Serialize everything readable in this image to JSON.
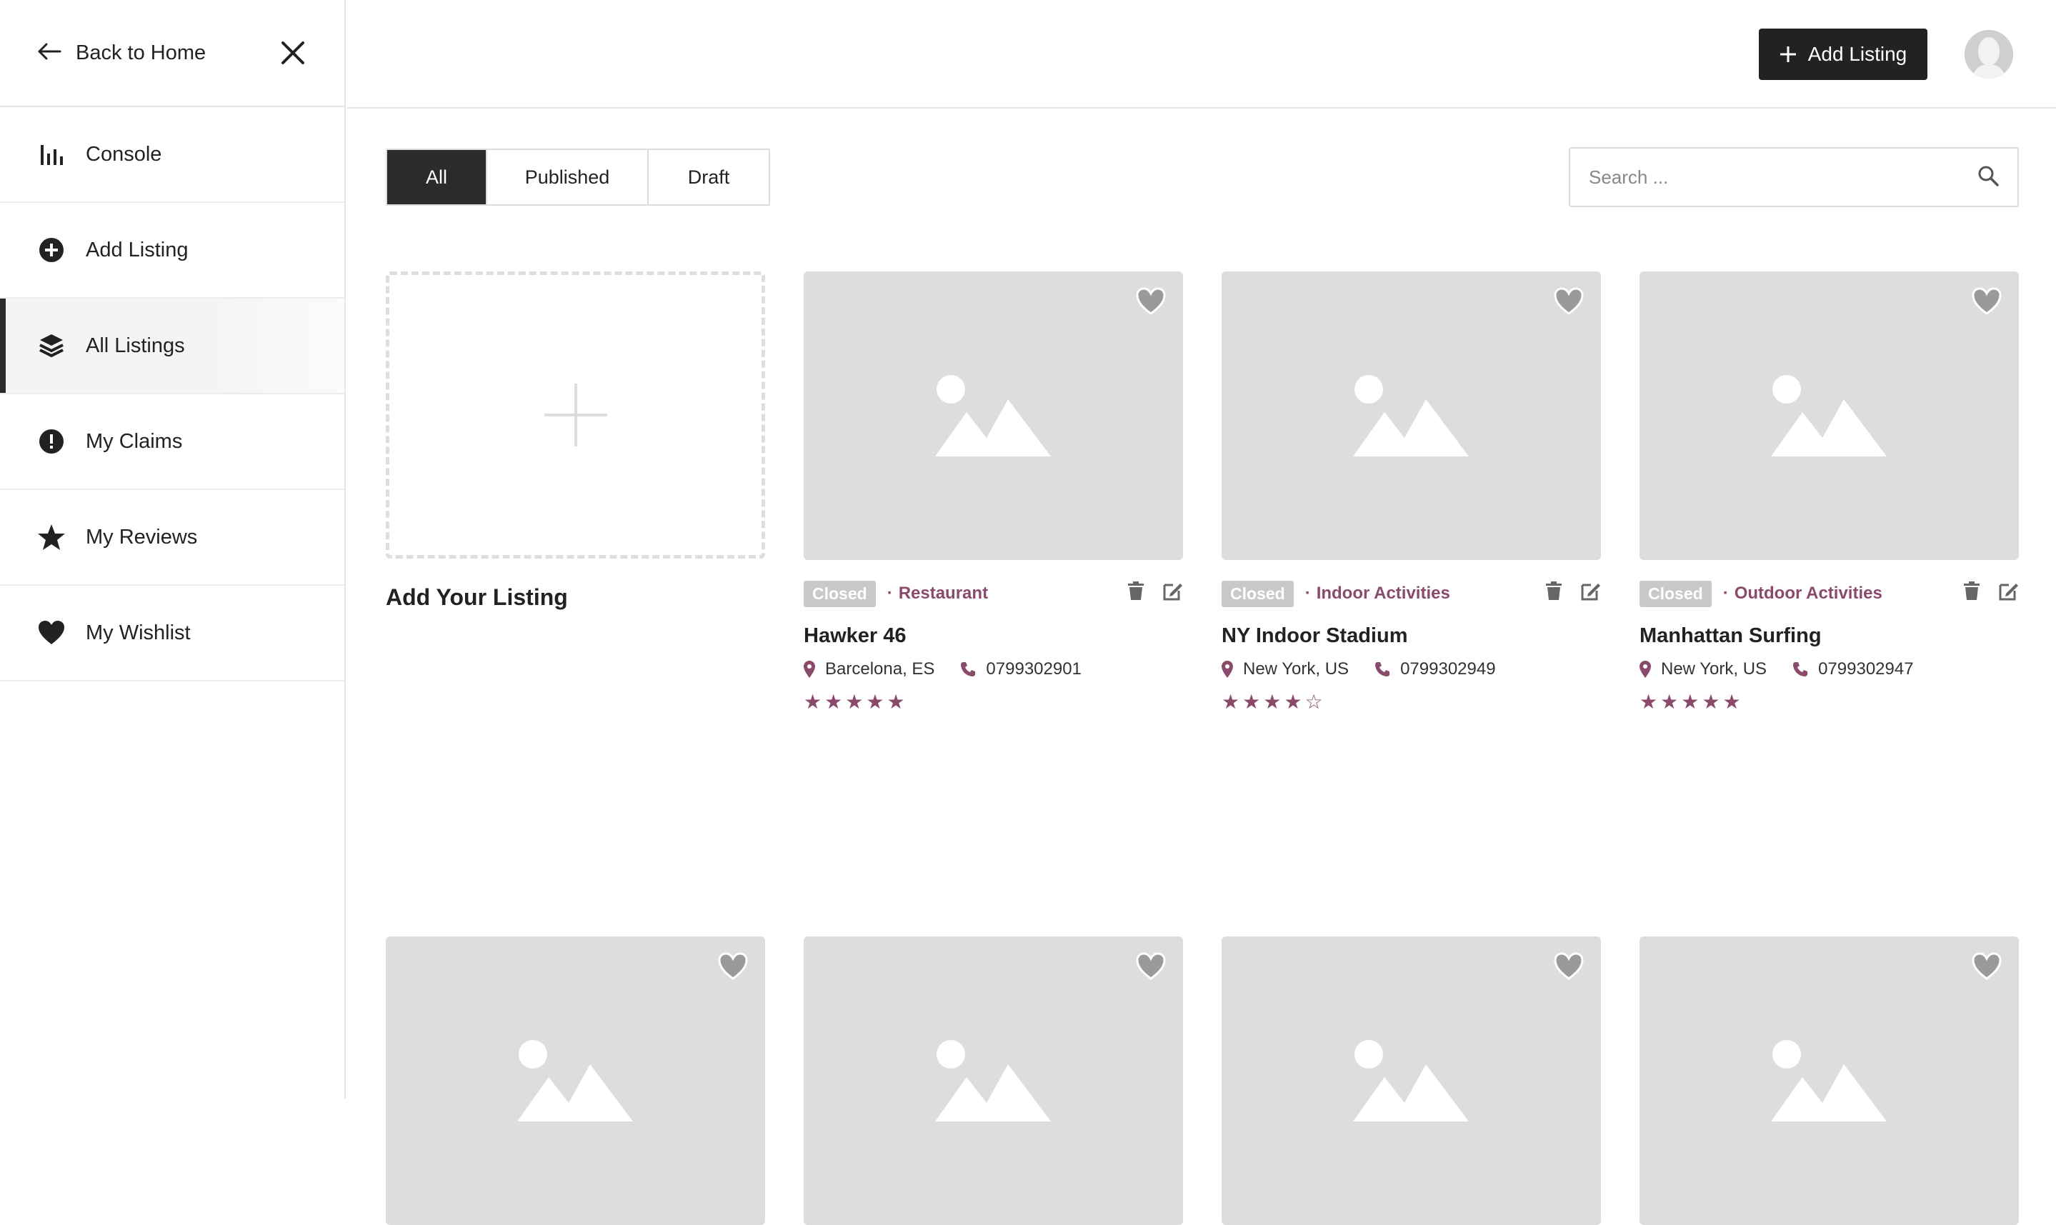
{
  "sidebar": {
    "back_label": "Back to Home",
    "items": [
      {
        "label": "Console",
        "icon": "chart-bars-icon"
      },
      {
        "label": "Add Listing",
        "icon": "plus-circle-icon"
      },
      {
        "label": "All Listings",
        "icon": "layers-icon",
        "active": true
      },
      {
        "label": "My Claims",
        "icon": "exclamation-circle-icon"
      },
      {
        "label": "My Reviews",
        "icon": "star-icon"
      },
      {
        "label": "My Wishlist",
        "icon": "heart-icon"
      }
    ]
  },
  "topbar": {
    "add_listing_label": "Add Listing"
  },
  "filters": {
    "tabs": [
      "All",
      "Published",
      "Draft"
    ],
    "active": "All"
  },
  "search": {
    "placeholder": "Search ..."
  },
  "add_card": {
    "title": "Add Your Listing"
  },
  "listings": [
    {
      "status": "Closed",
      "category": "Restaurant",
      "title": "Hawker 46",
      "location": "Barcelona, ES",
      "phone": "0799302901",
      "rating": 5
    },
    {
      "status": "Closed",
      "category": "Indoor Activities",
      "title": "NY Indoor Stadium",
      "location": "New York, US",
      "phone": "0799302949",
      "rating": 4
    },
    {
      "status": "Closed",
      "category": "Outdoor Activities",
      "title": "Manhattan Surfing",
      "location": "New York, US",
      "phone": "0799302947",
      "rating": 5
    }
  ],
  "colors": {
    "accent": "#8a4a6b",
    "dark": "#222222",
    "placeholder_bg": "#dddddd",
    "badge": "#c9c9c9"
  }
}
